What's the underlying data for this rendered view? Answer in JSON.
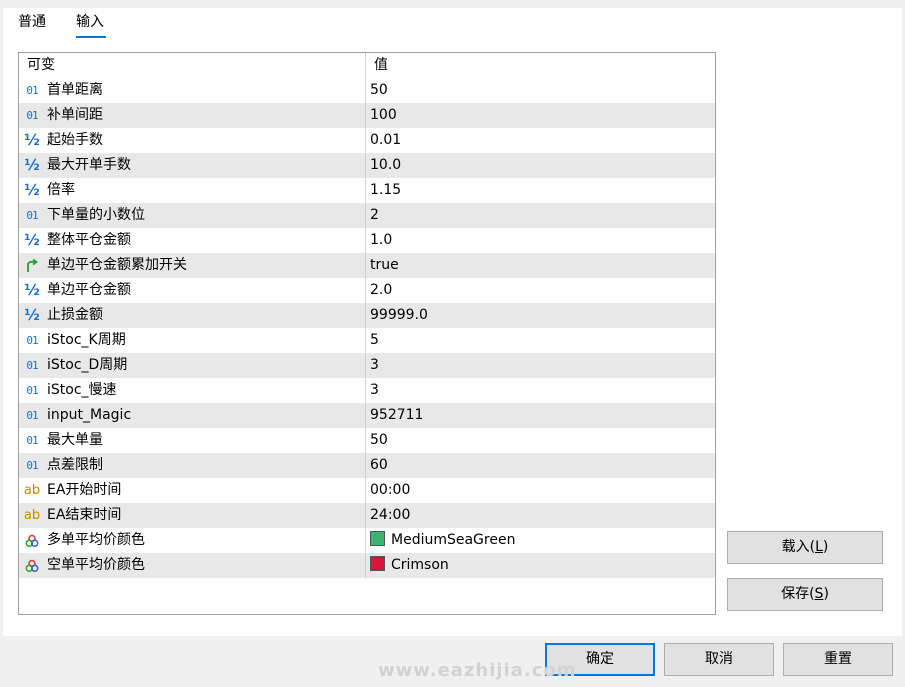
{
  "tabs": [
    {
      "label": "普通",
      "active": false
    },
    {
      "label": "输入",
      "active": true
    }
  ],
  "grid": {
    "header": {
      "name": "可变",
      "value": "值"
    },
    "rows": [
      {
        "type": "int",
        "icon": "01",
        "name": "首单距离",
        "value": "50"
      },
      {
        "type": "int",
        "icon": "01",
        "name": "补单间距",
        "value": "100"
      },
      {
        "type": "double",
        "icon": "½",
        "name": "起始手数",
        "value": "0.01"
      },
      {
        "type": "double",
        "icon": "½",
        "name": "最大开单手数",
        "value": "10.0"
      },
      {
        "type": "double",
        "icon": "½",
        "name": "倍率",
        "value": "1.15"
      },
      {
        "type": "int",
        "icon": "01",
        "name": "下单量的小数位",
        "value": "2"
      },
      {
        "type": "double",
        "icon": "½",
        "name": "整体平仓金额",
        "value": "1.0"
      },
      {
        "type": "bool",
        "icon": "",
        "name": "单边平仓金额累加开关",
        "value": "true"
      },
      {
        "type": "double",
        "icon": "½",
        "name": "单边平仓金额",
        "value": "2.0"
      },
      {
        "type": "double",
        "icon": "½",
        "name": "止损金额",
        "value": "99999.0"
      },
      {
        "type": "int",
        "icon": "01",
        "name": "iStoc_K周期",
        "value": "5"
      },
      {
        "type": "int",
        "icon": "01",
        "name": "iStoc_D周期",
        "value": "3"
      },
      {
        "type": "int",
        "icon": "01",
        "name": "iStoc_慢速",
        "value": "3"
      },
      {
        "type": "int",
        "icon": "01",
        "name": "input_Magic",
        "value": "952711"
      },
      {
        "type": "int",
        "icon": "01",
        "name": "最大单量",
        "value": "50"
      },
      {
        "type": "int",
        "icon": "01",
        "name": "点差限制",
        "value": "60"
      },
      {
        "type": "string",
        "icon": "ab",
        "name": "EA开始时间",
        "value": "00:00"
      },
      {
        "type": "string",
        "icon": "ab",
        "name": "EA结束时间",
        "value": "24:00"
      },
      {
        "type": "color",
        "icon": "",
        "name": "多单平均价颜色",
        "value": "MediumSeaGreen",
        "color": "#3cb371"
      },
      {
        "type": "color",
        "icon": "",
        "name": "空单平均价颜色",
        "value": "Crimson",
        "color": "#dc143c"
      }
    ]
  },
  "buttons": {
    "load_prefix": "载入(",
    "load_key": "L",
    "load_suffix": ")",
    "save_prefix": "保存(",
    "save_key": "S",
    "save_suffix": ")",
    "ok": "确定",
    "cancel": "取消",
    "reset": "重置"
  },
  "watermark": "www.eazhijia.com",
  "colors": {
    "accent": "#0078d7",
    "row_alt": "#e8e8e8",
    "icon_blue": "#1a6fd1",
    "icon_string": "#c08a00",
    "icon_bool": "#2e9e2e"
  }
}
